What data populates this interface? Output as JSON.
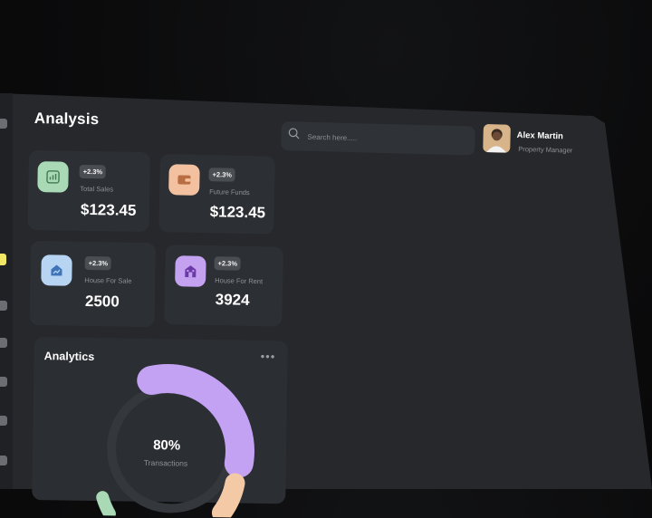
{
  "page": {
    "title": "Analysis"
  },
  "search": {
    "placeholder": "Search here....."
  },
  "user": {
    "name": "Alex Martin",
    "role": "Property Manager"
  },
  "cards": [
    {
      "badge": "+2.3%",
      "label": "Total Sales",
      "value": "$123.45",
      "icon": "chart-icon",
      "color": "#a9d9b5"
    },
    {
      "badge": "+2.3%",
      "label": "Future Funds",
      "value": "$123.45",
      "icon": "wallet-icon",
      "color": "#f3c1a0"
    },
    {
      "badge": "+2.3%",
      "label": "House For Sale",
      "value": "2500",
      "icon": "house-trend-icon",
      "color": "#b7d4f3"
    },
    {
      "badge": "+2.3%",
      "label": "House For Rent",
      "value": "3924",
      "icon": "building-icon",
      "color": "#c5a2f0"
    }
  ],
  "analytics": {
    "title": "Analytics",
    "percentage": "80%",
    "percentage_label": "Transactions",
    "colors": {
      "primary": "#c3a1f3",
      "secondary": "#f3c9a6",
      "tertiary": "#a9d9b5",
      "track": "#34373b"
    }
  },
  "sidebar": {
    "active_color": "#f2e866"
  }
}
